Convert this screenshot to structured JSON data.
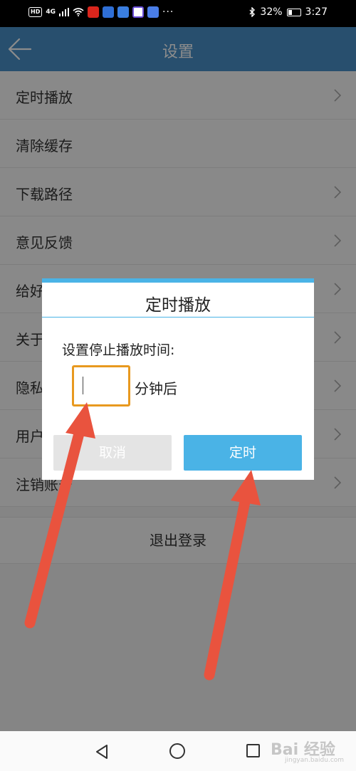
{
  "status_bar": {
    "hd": "HD",
    "network": "4G",
    "battery": "32%",
    "battery_level": 0.32,
    "time": "3:27",
    "more": "···"
  },
  "app_bar": {
    "title": "设置"
  },
  "settings": {
    "items": [
      {
        "label": "定时播放"
      },
      {
        "label": "清除缓存"
      },
      {
        "label": "下载路径"
      },
      {
        "label": "意见反馈"
      },
      {
        "label": "给好"
      },
      {
        "label": "关于"
      },
      {
        "label": "隐私"
      },
      {
        "label": "用户"
      },
      {
        "label": "注销账号"
      }
    ],
    "logout_label": "退出登录"
  },
  "dialog": {
    "title": "定时播放",
    "prompt": "设置停止播放时间:",
    "minutes_value": "",
    "minutes_suffix": "分钟后",
    "cancel_label": "取消",
    "confirm_label": "定时"
  },
  "watermark": {
    "text": "Bai 经验",
    "sub": "jingyan.baidu.com"
  },
  "colors": {
    "app_bar": "#4a91c9",
    "dialog_accent": "#4ab3e6",
    "input_highlight": "#e8991f",
    "arrow": "#e9533e"
  }
}
